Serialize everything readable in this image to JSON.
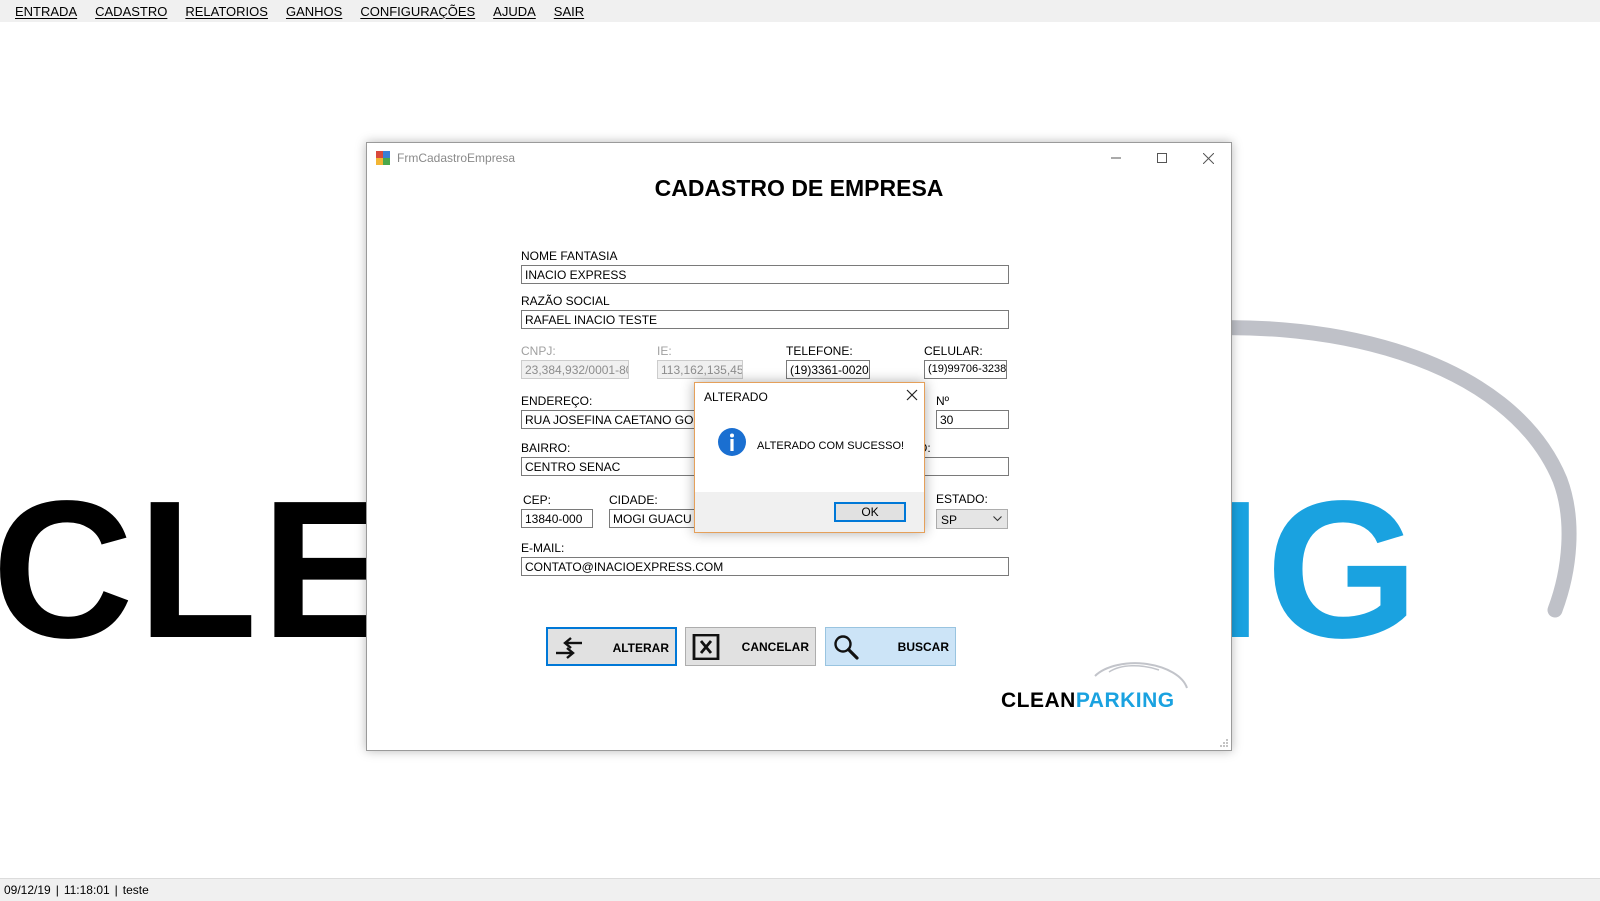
{
  "menu": {
    "items": [
      "ENTRADA",
      "CADASTRO",
      "RELATORIOS",
      "GANHOS",
      "CONFIGURAÇÕES",
      "AJUDA",
      "SAIR"
    ]
  },
  "background_logo": {
    "left_text": "CLE",
    "right_text": "ING",
    "colors": {
      "dark": "#000000",
      "accent": "#1aa2e0"
    }
  },
  "form": {
    "window_title": "FrmCadastroEmpresa",
    "heading": "CADASTRO DE EMPRESA",
    "fields": {
      "nome_fantasia": {
        "label": "NOME FANTASIA",
        "value": "INACIO EXPRESS"
      },
      "razao_social": {
        "label": "RAZÃO SOCIAL",
        "value": "RAFAEL INACIO TESTE"
      },
      "cnpj": {
        "label": "CNPJ:",
        "value": "23,384,932/0001-80"
      },
      "ie": {
        "label": "IE:",
        "value": "113,162,135,45_"
      },
      "telefone": {
        "label": "TELEFONE:",
        "value": "(19)3361-0020"
      },
      "celular": {
        "label": "CELULAR:",
        "value": "(19)99706-3238"
      },
      "endereco": {
        "label": "ENDEREÇO:",
        "value": "RUA JOSEFINA CAETANO GONÇA"
      },
      "numero": {
        "label": "Nº",
        "value": "30"
      },
      "bairro": {
        "label": "BAIRRO:",
        "value": "CENTRO SENAC"
      },
      "complemento": {
        "label": "O:",
        "value": ""
      },
      "cep": {
        "label": "CEP:",
        "value": "13840-000"
      },
      "cidade": {
        "label": "CIDADE:",
        "value": "MOGI GUACU"
      },
      "estado": {
        "label": "ESTADO:",
        "value": "SP"
      },
      "email": {
        "label": "E-MAIL:",
        "value": "CONTATO@INACIOEXPRESS.COM"
      }
    },
    "buttons": {
      "alterar": "ALTERAR",
      "cancelar": "CANCELAR",
      "buscar": "BUSCAR"
    },
    "logo": {
      "part1": "CLEAN",
      "part2": "PARKING"
    }
  },
  "dialog": {
    "title": "ALTERADO",
    "message": "ALTERADO COM SUCESSO!",
    "ok_label": "OK"
  },
  "status": {
    "date": "09/12/19",
    "time": "11:18:01",
    "user": "teste"
  }
}
